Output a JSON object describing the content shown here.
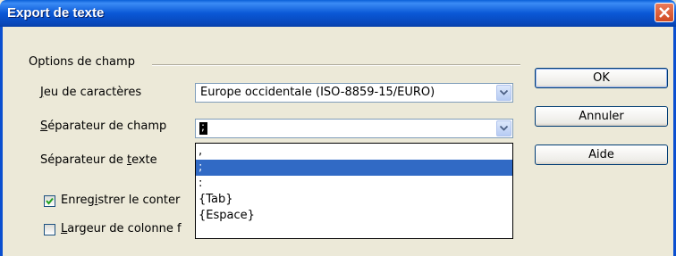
{
  "window": {
    "title": "Export de texte"
  },
  "group": {
    "label": "Options de champ"
  },
  "charset": {
    "label_pre": "",
    "label_ul": "J",
    "label_post": "eu de caractères",
    "value": "Europe occidentale (ISO-8859-15/EURO)"
  },
  "field_sep": {
    "label_pre": "",
    "label_ul": "S",
    "label_post": "éparateur de champ",
    "value": ";",
    "options": [
      ",",
      ";",
      ":",
      "{Tab}",
      "{Espace}"
    ],
    "selected_index": 1
  },
  "text_sep": {
    "label_pre": "Séparateur de ",
    "label_ul": "t",
    "label_post": "exte"
  },
  "save_content": {
    "label_pre": "Enreg",
    "label_ul": "i",
    "label_post": "strer le conter",
    "checked": true
  },
  "fixed_width": {
    "label_pre": "",
    "label_ul": "L",
    "label_post": "argeur de colonne f",
    "checked": false
  },
  "buttons": {
    "ok": "OK",
    "cancel": "Annuler",
    "help": "Aide"
  },
  "colors": {
    "title_bar": "#0a58d6",
    "selection": "#316ac5",
    "dialog_bg": "#ece9d8"
  },
  "icons": {
    "close": "close-icon",
    "dropdown": "chevron-down-icon",
    "check": "checkmark-icon"
  }
}
